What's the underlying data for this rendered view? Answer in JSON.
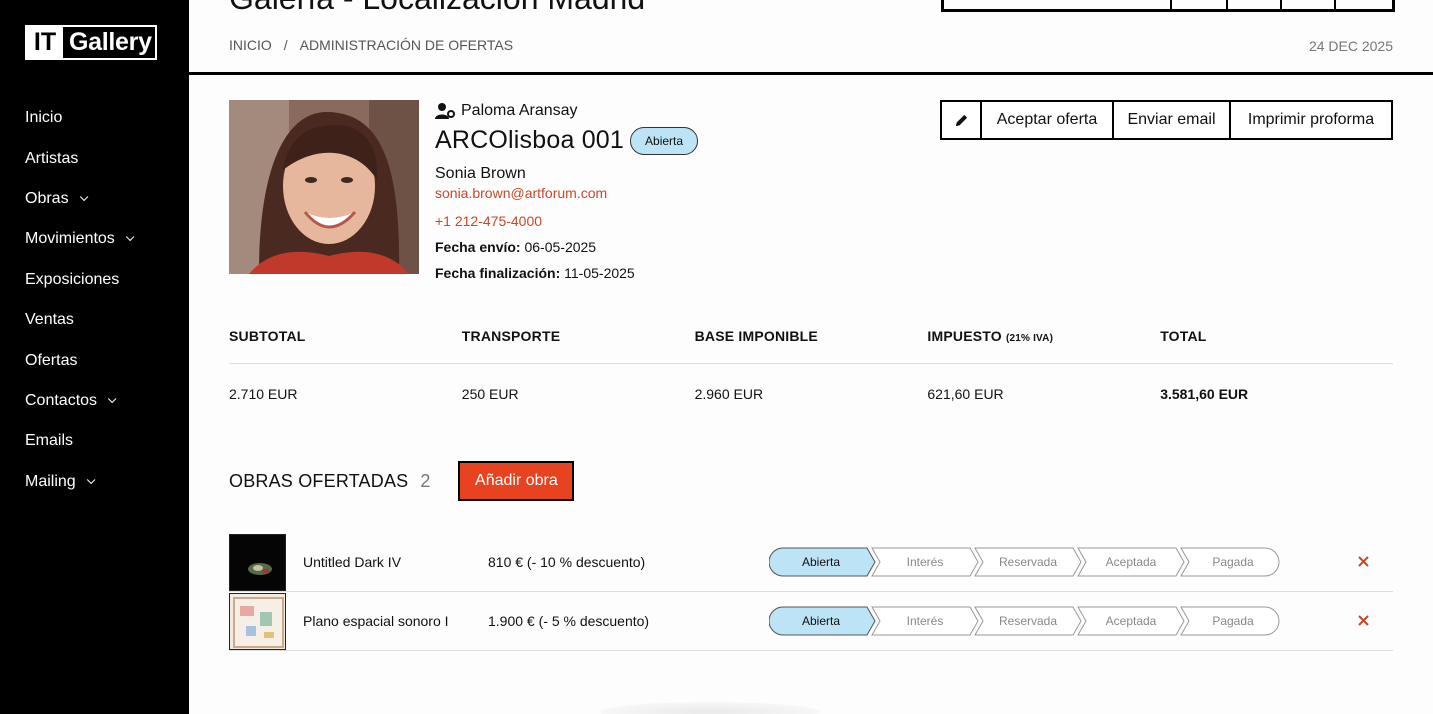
{
  "sidebar": {
    "logo_it": "IT",
    "logo_gallery": "Gallery",
    "items": [
      {
        "label": "Inicio",
        "has_submenu": false
      },
      {
        "label": "Artistas",
        "has_submenu": false
      },
      {
        "label": "Obras",
        "has_submenu": true
      },
      {
        "label": "Movimientos",
        "has_submenu": true
      },
      {
        "label": "Exposiciones",
        "has_submenu": false
      },
      {
        "label": "Ventas",
        "has_submenu": false
      },
      {
        "label": "Ofertas",
        "has_submenu": false
      },
      {
        "label": "Contactos",
        "has_submenu": true
      },
      {
        "label": "Emails",
        "has_submenu": false
      },
      {
        "label": "Mailing",
        "has_submenu": true
      }
    ]
  },
  "header": {
    "title": "Galería - Localización Madrid",
    "breadcrumb": [
      "INICIO",
      "/",
      "ADMINISTRACIÓN DE OFERTAS"
    ],
    "date": "24 DEC 2025"
  },
  "offer": {
    "agent": "Paloma Aransay",
    "title": "ARCOlisboa 001",
    "status": "Abierta",
    "client_name": "Sonia Brown",
    "client_email": "sonia.brown@artforum.com",
    "client_phone": "+1 212-475-4000",
    "fecha_envio_label": "Fecha envío:",
    "fecha_envio": "06-05-2025",
    "fecha_fin_label": "Fecha finalización:",
    "fecha_fin": "11-05-2025"
  },
  "actions": {
    "accept": "Aceptar oferta",
    "email": "Enviar email",
    "print": "Imprimir proforma"
  },
  "totals": {
    "headers": {
      "subtotal": "SUBTOTAL",
      "transporte": "TRANSPORTE",
      "base": "BASE IMPONIBLE",
      "impuesto": "IMPUESTO",
      "impuesto_note": "(21% IVA)",
      "total": "TOTAL"
    },
    "values": {
      "subtotal": "2.710 EUR",
      "transporte": "250 EUR",
      "base": "2.960 EUR",
      "impuesto": "621,60 EUR",
      "total": "3.581,60 EUR"
    }
  },
  "obras": {
    "title": "OBRAS OFERTADAS",
    "count": "2",
    "add_label": "Añadir obra",
    "stages": [
      "Abierta",
      "Interés",
      "Reservada",
      "Aceptada",
      "Pagada"
    ],
    "rows": [
      {
        "name": "Untitled Dark IV",
        "price": "810 € (- 10 % descuento)",
        "active_stage": "Abierta"
      },
      {
        "name": "Plano espacial sonoro I",
        "price": "1.900 € (- 5 % descuento)",
        "active_stage": "Abierta"
      }
    ]
  },
  "colors": {
    "accent": "#e84320",
    "link": "#c8472a",
    "badge_bg": "#bde3f7",
    "sidebar_bg": "#000000"
  }
}
